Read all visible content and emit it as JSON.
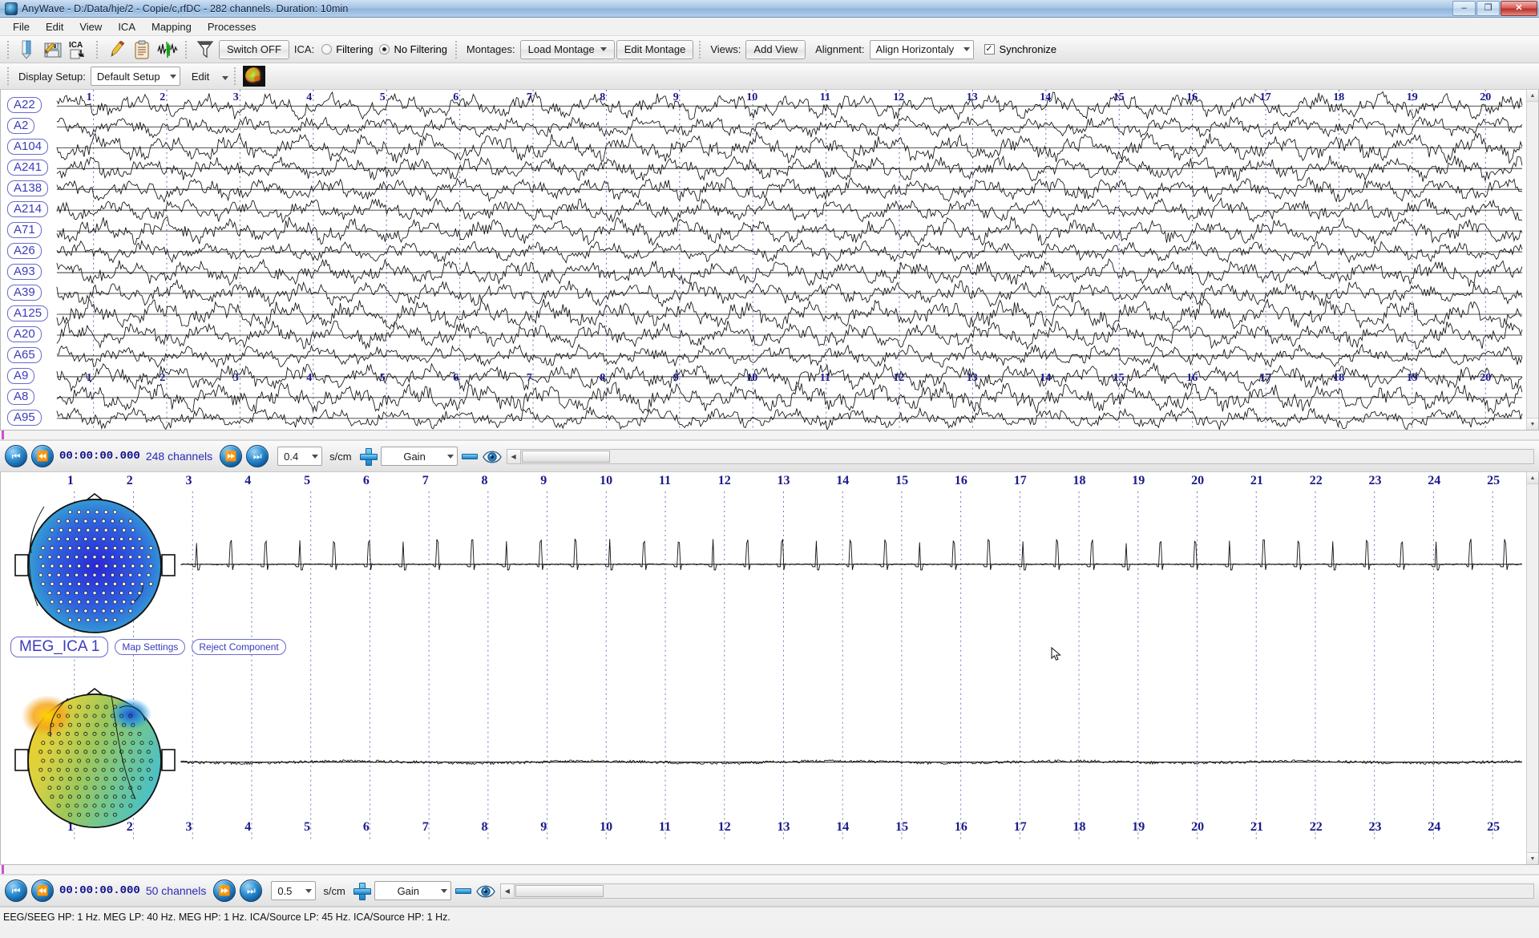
{
  "window": {
    "title": "AnyWave - D:/Data/hje/2 - Copie/c,rfDC - 282 channels. Duration: 10min",
    "app_icon": "anywave-logo-icon",
    "minimize_label": "–",
    "maximize_label": "❐",
    "close_label": "✕"
  },
  "menubar": {
    "items": [
      {
        "label": "File"
      },
      {
        "label": "Edit"
      },
      {
        "label": "View"
      },
      {
        "label": "ICA"
      },
      {
        "label": "Mapping"
      },
      {
        "label": "Processes"
      }
    ]
  },
  "toolbar": {
    "icons": [
      {
        "name": "open-file-icon",
        "glyph": "↓"
      },
      {
        "name": "save-file-icon",
        "glyph": "💾"
      },
      {
        "name": "ica-import-icon",
        "glyph": "ICA"
      },
      {
        "name": "edit-pencil-icon",
        "glyph": "✎"
      },
      {
        "name": "clipboard-icon",
        "glyph": "📋"
      },
      {
        "name": "signal-trace-icon",
        "glyph": "⨝"
      },
      {
        "name": "filter-funnel-icon",
        "glyph": "▽"
      }
    ],
    "switch_off_label": "Switch OFF",
    "ica_label": "ICA:",
    "filtering_label": "Filtering",
    "filtering_selected": false,
    "no_filtering_label": "No Filtering",
    "no_filtering_selected": true,
    "montages_label": "Montages:",
    "load_montage_label": "Load Montage",
    "edit_montage_label": "Edit Montage",
    "views_label": "Views:",
    "add_view_label": "Add View",
    "alignment_label": "Alignment:",
    "alignment_value": "Align Horizontaly",
    "synchronize_label": "Synchronize",
    "synchronize_checked": true,
    "synchronize_check_glyph": "✓"
  },
  "toolbar2": {
    "display_setup_label": "Display Setup:",
    "display_setup_value": "Default Setup",
    "edit_label": "Edit",
    "topo_thumbnail_name": "topography-thumbnail-icon"
  },
  "panel_top": {
    "channels": [
      "A22",
      "A2",
      "A104",
      "A241",
      "A138",
      "A214",
      "A71",
      "A26",
      "A93",
      "A39",
      "A125",
      "A20",
      "A65",
      "A9",
      "A8",
      "A95"
    ],
    "time_ticks": [
      "1",
      "2",
      "3",
      "4",
      "5",
      "6",
      "7",
      "8",
      "9",
      "10",
      "11",
      "12",
      "13",
      "14",
      "15",
      "16",
      "17",
      "18",
      "19",
      "20"
    ],
    "nav": {
      "first_label": "⏮",
      "prev_label": "⏪",
      "next_label": "⏩",
      "last_label": "⏭",
      "timecode": "00:00:00.000",
      "channel_count": "248 channels",
      "seconds_per_cm_value": "0.4",
      "seconds_per_cm_unit": "s/cm",
      "gain_label": "Gain",
      "increase_gain_name": "increase-gain-icon",
      "decrease_gain_name": "decrease-gain-icon",
      "eye_name": "show-hide-channels-icon"
    }
  },
  "panel_bottom": {
    "time_ticks": [
      "1",
      "2",
      "3",
      "4",
      "5",
      "6",
      "7",
      "8",
      "9",
      "10",
      "11",
      "12",
      "13",
      "14",
      "15",
      "16",
      "17",
      "18",
      "19",
      "20",
      "21",
      "22",
      "23",
      "24",
      "25"
    ],
    "components": [
      {
        "label": "MEG_ICA 1",
        "map_settings_label": "Map Settings",
        "reject_component_label": "Reject Component",
        "topo_name": "topography-map-ica1",
        "topo_colors": [
          "#2b2bd6",
          "#2f6fe0",
          "#3fa6d6",
          "#45c8c0"
        ]
      },
      {
        "label": "",
        "topo_name": "topography-map-ica2",
        "topo_colors": [
          "#f2d21a",
          "#f59b1c",
          "#8fbf4a",
          "#45b8c8",
          "#2f5fd6"
        ]
      }
    ],
    "nav": {
      "first_label": "⏮",
      "prev_label": "⏪",
      "next_label": "⏩",
      "last_label": "⏭",
      "timecode": "00:00:00.000",
      "channel_count": "50 channels",
      "seconds_per_cm_value": "0.5",
      "seconds_per_cm_unit": "s/cm",
      "gain_label": "Gain",
      "increase_gain_name": "increase-gain-icon",
      "decrease_gain_name": "decrease-gain-icon",
      "eye_name": "show-hide-channels-icon"
    }
  },
  "statusbar": {
    "text": "EEG/SEEG HP: 1 Hz. MEG LP: 40 Hz. MEG HP: 1 Hz. ICA/Source LP: 45 Hz. ICA/Source HP: 1 Hz."
  },
  "colors": {
    "tick_blue": "#1a1a8c",
    "label_blue": "#3b3bbd",
    "timecode_blue": "#0e0e8c",
    "marker_magenta": "#cf4fd0"
  }
}
